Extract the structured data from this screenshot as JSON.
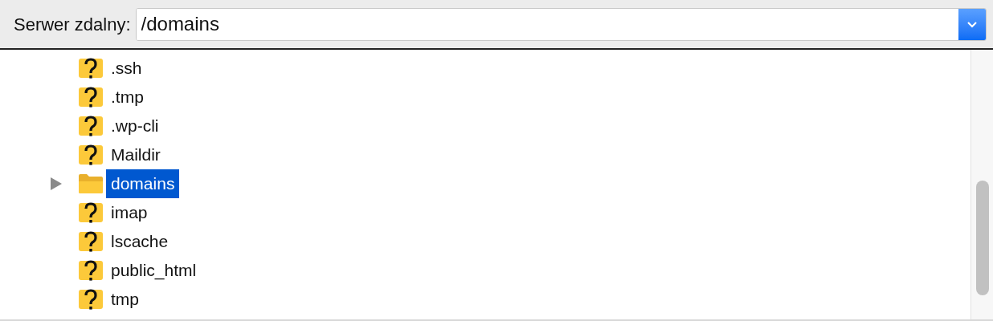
{
  "server_path": {
    "label": "Serwer zdalny:",
    "value": "/domains"
  },
  "tree": {
    "items": [
      {
        "name": ".ssh",
        "kind": "unknown",
        "selected": false
      },
      {
        "name": ".tmp",
        "kind": "unknown",
        "selected": false
      },
      {
        "name": ".wp-cli",
        "kind": "unknown",
        "selected": false
      },
      {
        "name": "Maildir",
        "kind": "unknown",
        "selected": false
      },
      {
        "name": "domains",
        "kind": "folder",
        "expanded": false,
        "selected": true
      },
      {
        "name": "imap",
        "kind": "unknown",
        "selected": false
      },
      {
        "name": "lscache",
        "kind": "unknown",
        "selected": false
      },
      {
        "name": "public_html",
        "kind": "unknown",
        "selected": false
      },
      {
        "name": "tmp",
        "kind": "unknown",
        "selected": false
      }
    ]
  }
}
